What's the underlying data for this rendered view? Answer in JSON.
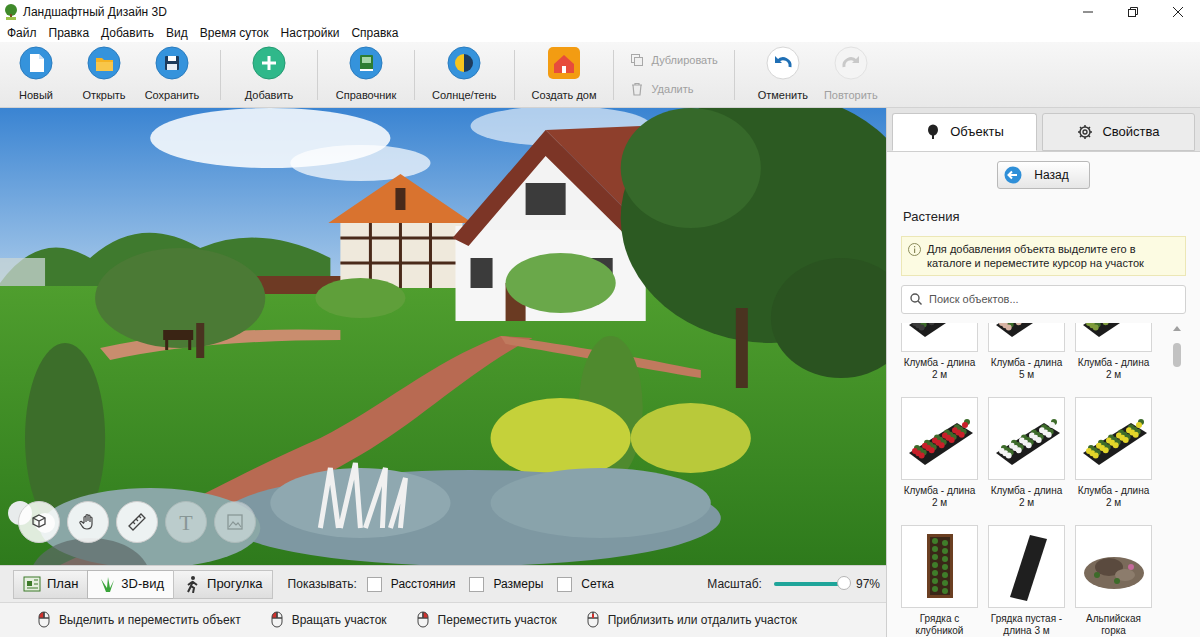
{
  "window": {
    "title": "Ландшафтный Дизайн 3D"
  },
  "menu": [
    "Файл",
    "Правка",
    "Добавить",
    "Вид",
    "Время суток",
    "Настройки",
    "Справка"
  ],
  "toolbar": [
    {
      "label": "Новый",
      "kind": "large",
      "disabled": false
    },
    {
      "label": "Открыть",
      "kind": "large",
      "disabled": false
    },
    {
      "label": "Сохранить",
      "kind": "large",
      "disabled": false
    },
    {
      "label": "Добавить",
      "kind": "large",
      "disabled": false
    },
    {
      "label": "Справочник",
      "kind": "large",
      "disabled": false
    },
    {
      "label": "Солнце/тень",
      "kind": "large",
      "disabled": false
    },
    {
      "label": "Создать дом",
      "kind": "large",
      "disabled": false
    },
    {
      "label": "Дублировать",
      "kind": "small",
      "disabled": true
    },
    {
      "label": "Удалить",
      "kind": "small",
      "disabled": true
    },
    {
      "label": "Отменить",
      "kind": "large",
      "disabled": false
    },
    {
      "label": "Повторить",
      "kind": "large",
      "disabled": true
    }
  ],
  "view_tools": [
    {
      "kind": "icon",
      "disabled": false
    },
    {
      "kind": "icon",
      "disabled": false
    },
    {
      "kind": "icon",
      "disabled": false
    },
    {
      "kind": "glyph",
      "text": "T",
      "disabled": true
    },
    {
      "kind": "icon",
      "disabled": true
    }
  ],
  "view_tabs": [
    {
      "label": "План",
      "selected": false
    },
    {
      "label": "3D-вид",
      "selected": true
    },
    {
      "label": "Прогулка",
      "selected": false
    }
  ],
  "show": {
    "label": "Показывать:",
    "options": [
      {
        "label": "Расстояния",
        "checked": false
      },
      {
        "label": "Размеры",
        "checked": false
      },
      {
        "label": "Сетка",
        "checked": false
      }
    ]
  },
  "zoom": {
    "label": "Масштаб:",
    "level": 0.97,
    "reading": "97%"
  },
  "status_bar": [
    "Выделить и переместить объект",
    "Вращать участок",
    "Переместить участок",
    "Приблизить или отдалить участок"
  ],
  "panel": {
    "tabs": [
      {
        "label": "Объекты",
        "selected": true
      },
      {
        "label": "Свойства",
        "selected": false
      }
    ],
    "back": "Назад",
    "heading": "Растения",
    "info": "Для добавления объекта выделите его в каталоге и переместите курсор на участок",
    "search": {
      "placeholder": "Поиск объектов..."
    },
    "items": [
      {
        "label": "Клумба - длина 2 м",
        "kind": "bed",
        "color": "#3a3a3a"
      },
      {
        "label": "Клумба - длина 5 м",
        "kind": "bed",
        "color": "#d8b4a4"
      },
      {
        "label": "Клумба - длина 2 м",
        "kind": "bed",
        "color": "#7f9c3c"
      },
      {
        "label": "Клумба - длина 2 м",
        "kind": "bed",
        "color": "#c8202a"
      },
      {
        "label": "Клумба - длина 2 м",
        "kind": "bed",
        "color": "#f4f4f4"
      },
      {
        "label": "Клумба - длина 2 м",
        "kind": "bed",
        "color": "#e3d52a"
      },
      {
        "label": "Грядка с клубникой",
        "kind": "garden",
        "color": "#3f7d2a"
      },
      {
        "label": "Грядка пустая - длина 3 м",
        "kind": "empty",
        "color": "#1f1f1f"
      },
      {
        "label": "Альпийская горка",
        "kind": "rock",
        "color": "#7a6a5a"
      }
    ]
  }
}
